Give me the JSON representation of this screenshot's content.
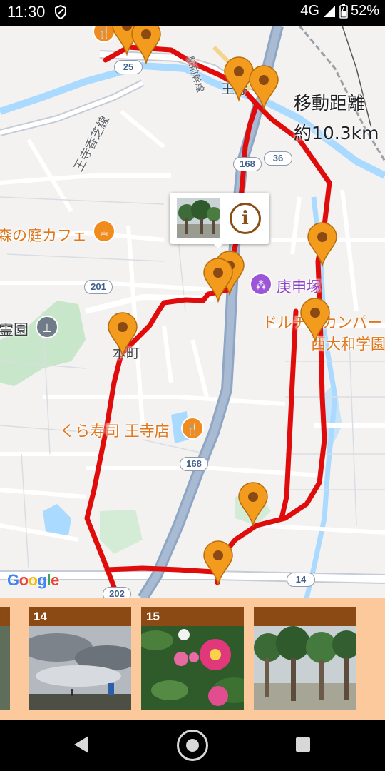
{
  "status_bar": {
    "time": "11:30",
    "network": "4G",
    "battery": "52%"
  },
  "map": {
    "distance_label": "移動距離",
    "distance_value": "約10.3km",
    "places": {
      "cafe": "森の庭カフェ",
      "koshinzuka": "庚申塚",
      "reien": "霊園",
      "honmachi": "本町",
      "kura_sushi": "くら寿司 王寺店",
      "dolce": "ドルチェカンパー",
      "nishiyamato": "西大和学園",
      "ouji_line": "王寺香芝線",
      "ekimae": "駅前幹線",
      "station": "王寺"
    },
    "routes": [
      "25",
      "168",
      "36",
      "201",
      "168",
      "14",
      "202"
    ],
    "attribution": "Google",
    "accent_color": "#e00b0b",
    "pin_color": "#f29b1d"
  },
  "thumbnails": [
    {
      "label": "",
      "kind": "partial"
    },
    {
      "label": "14",
      "kind": "sky"
    },
    {
      "label": "15",
      "kind": "flowers"
    },
    {
      "label": "",
      "kind": "trees"
    }
  ],
  "nav": {
    "back": "back-icon",
    "home": "home-icon",
    "recents": "recents-icon"
  }
}
